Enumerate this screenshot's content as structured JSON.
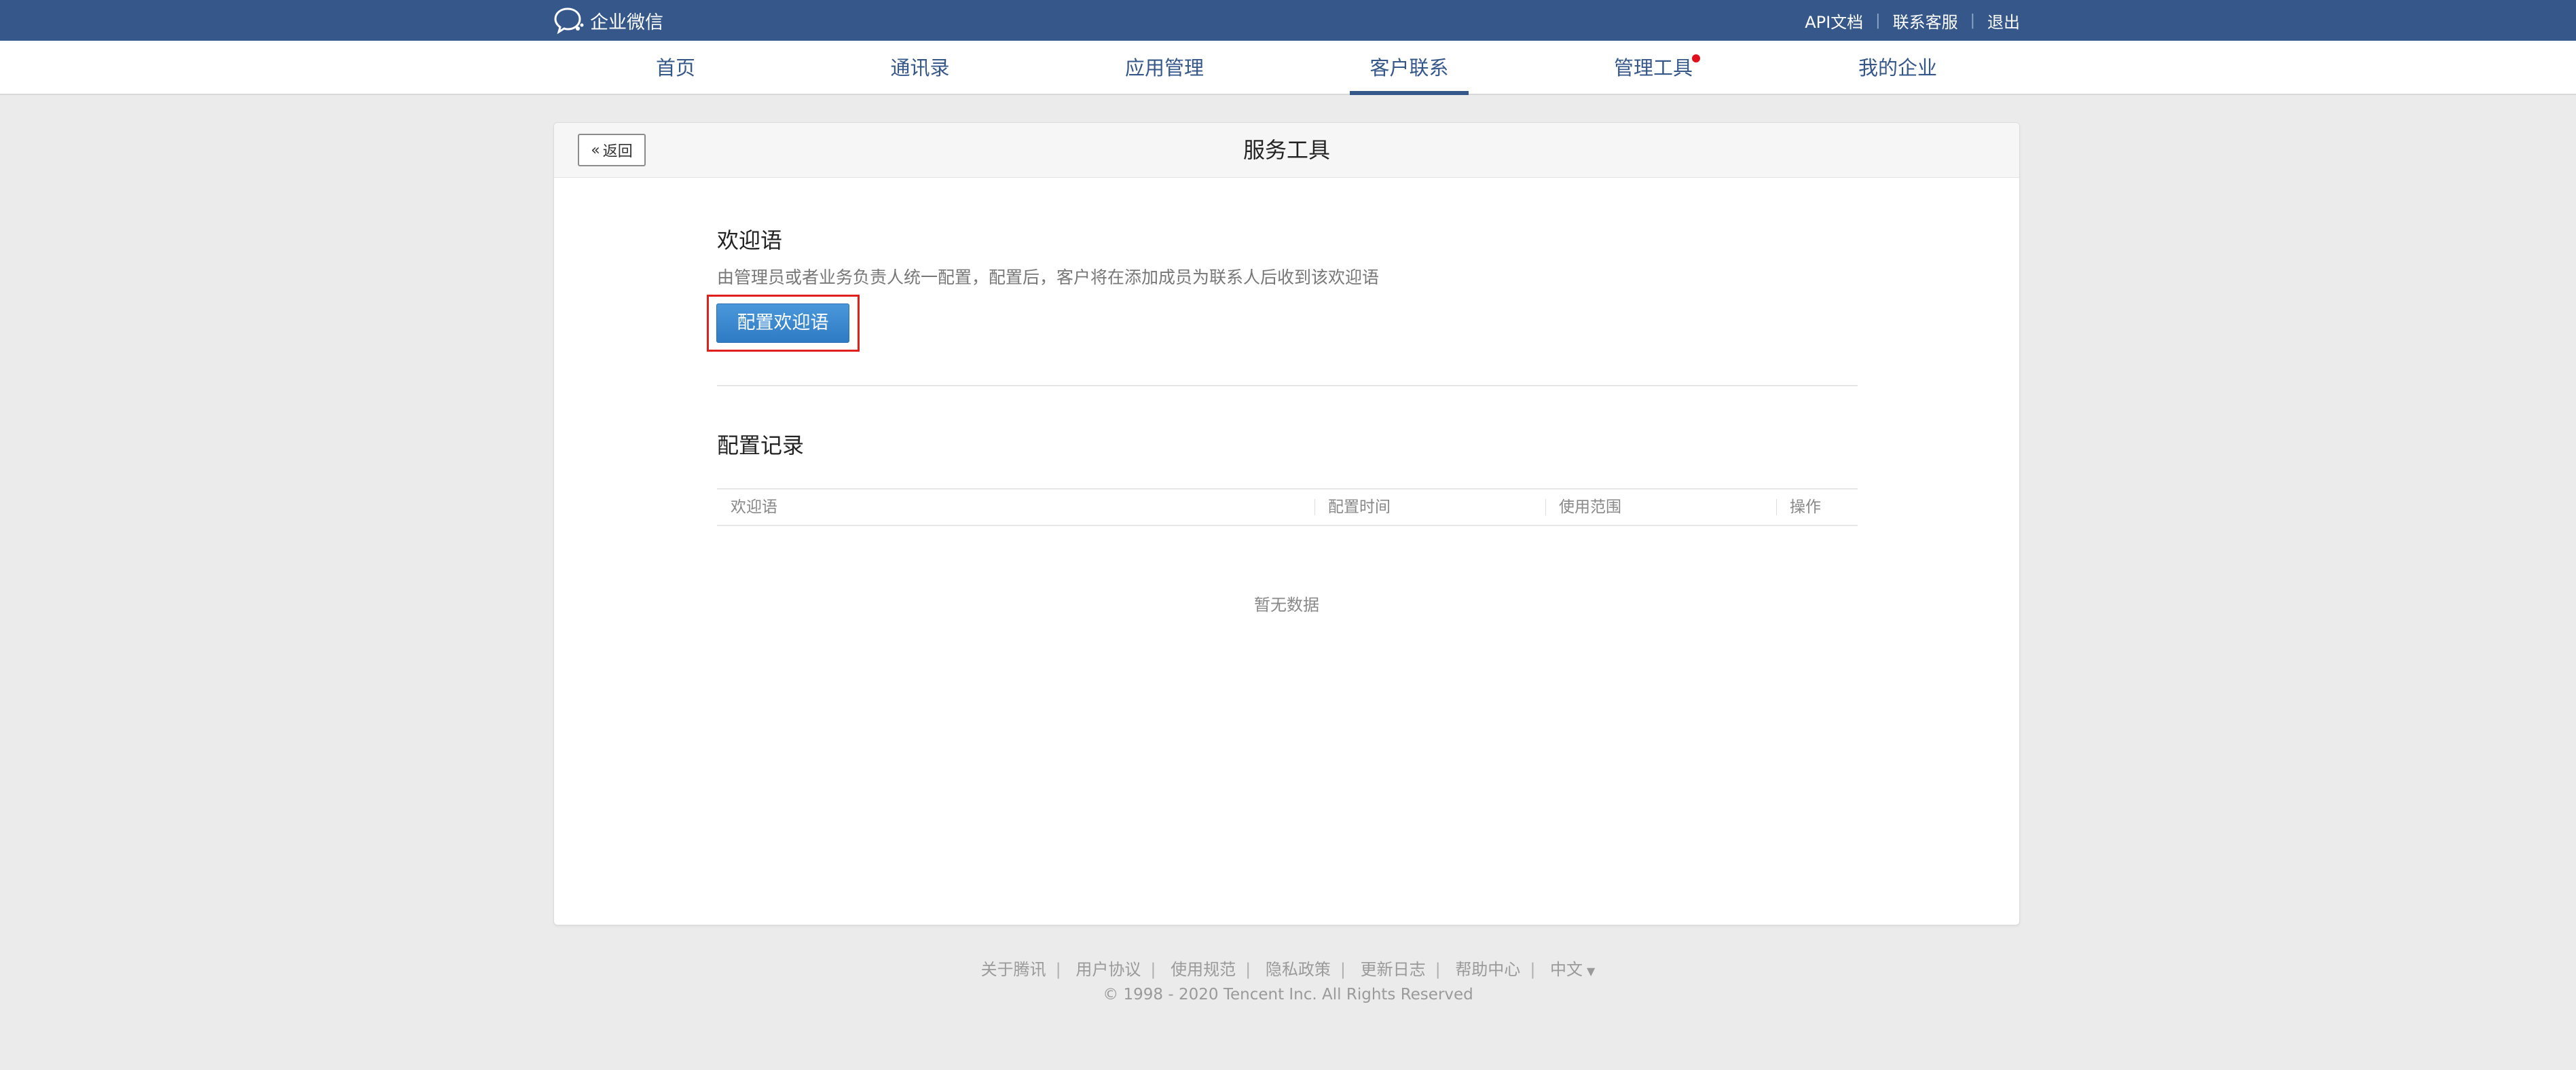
{
  "topbar": {
    "brand": "企业微信",
    "links": [
      "API文档",
      "联系客服",
      "退出"
    ],
    "separator": "|"
  },
  "nav": {
    "items": [
      {
        "label": "首页"
      },
      {
        "label": "通讯录"
      },
      {
        "label": "应用管理"
      },
      {
        "label": "客户联系",
        "active": true
      },
      {
        "label": "管理工具",
        "badge": "red-dot"
      },
      {
        "label": "我的企业"
      }
    ]
  },
  "card": {
    "back_label": "返回",
    "title": "服务工具"
  },
  "welcome": {
    "title": "欢迎语",
    "description": "由管理员或者业务负责人统一配置，配置后，客户将在添加成员为联系人后收到该欢迎语",
    "button_label": "配置欢迎语"
  },
  "records": {
    "title": "配置记录",
    "columns": [
      "欢迎语",
      "配置时间",
      "使用范围",
      "操作"
    ],
    "empty_text": "暂无数据"
  },
  "footer": {
    "links": [
      "关于腾讯",
      "用户协议",
      "使用规范",
      "隐私政策",
      "更新日志",
      "帮助中心",
      "中文"
    ],
    "copyright": "© 1998 - 2020 Tencent Inc. All Rights Reserved"
  },
  "colors": {
    "topbar_bg": "#35578a",
    "accent_blue": "#3a87d0",
    "highlight_red": "#e0201d",
    "badge_red": "#e0101d"
  }
}
